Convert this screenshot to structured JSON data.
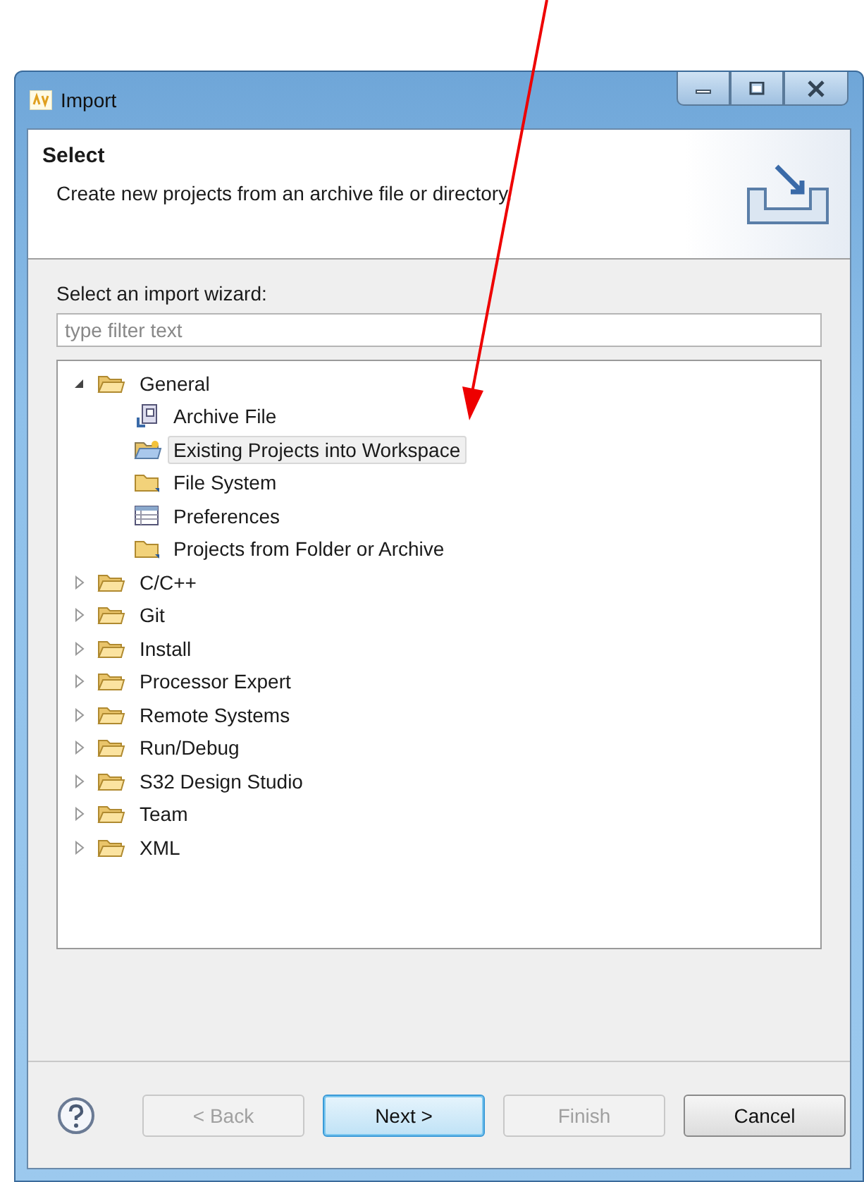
{
  "window": {
    "title": "Import"
  },
  "header": {
    "title": "Select",
    "description": "Create new projects from an archive file or directory."
  },
  "filter": {
    "label": "Select an import wizard:",
    "placeholder": "type filter text"
  },
  "tree": [
    {
      "label": "General",
      "expanded": true,
      "selected": false,
      "children": [
        {
          "label": "Archive File",
          "kind": "archive",
          "selected": false
        },
        {
          "label": "Existing Projects into Workspace",
          "kind": "project",
          "selected": true
        },
        {
          "label": "File System",
          "kind": "folder",
          "selected": false
        },
        {
          "label": "Preferences",
          "kind": "preferences",
          "selected": false
        },
        {
          "label": "Projects from Folder or Archive",
          "kind": "folder",
          "selected": false
        }
      ]
    },
    {
      "label": "C/C++",
      "expanded": false,
      "selected": false
    },
    {
      "label": "Git",
      "expanded": false,
      "selected": false
    },
    {
      "label": "Install",
      "expanded": false,
      "selected": false
    },
    {
      "label": "Processor Expert",
      "expanded": false,
      "selected": false
    },
    {
      "label": "Remote Systems",
      "expanded": false,
      "selected": false
    },
    {
      "label": "Run/Debug",
      "expanded": false,
      "selected": false
    },
    {
      "label": "S32 Design Studio",
      "expanded": false,
      "selected": false
    },
    {
      "label": "Team",
      "expanded": false,
      "selected": false
    },
    {
      "label": "XML",
      "expanded": false,
      "selected": false
    }
  ],
  "buttons": [
    {
      "label": "< Back",
      "disabled": true,
      "default": false
    },
    {
      "label": "Next >",
      "disabled": false,
      "default": true
    },
    {
      "label": "Finish",
      "disabled": true,
      "default": false
    },
    {
      "label": "Cancel",
      "disabled": false,
      "default": false
    }
  ]
}
